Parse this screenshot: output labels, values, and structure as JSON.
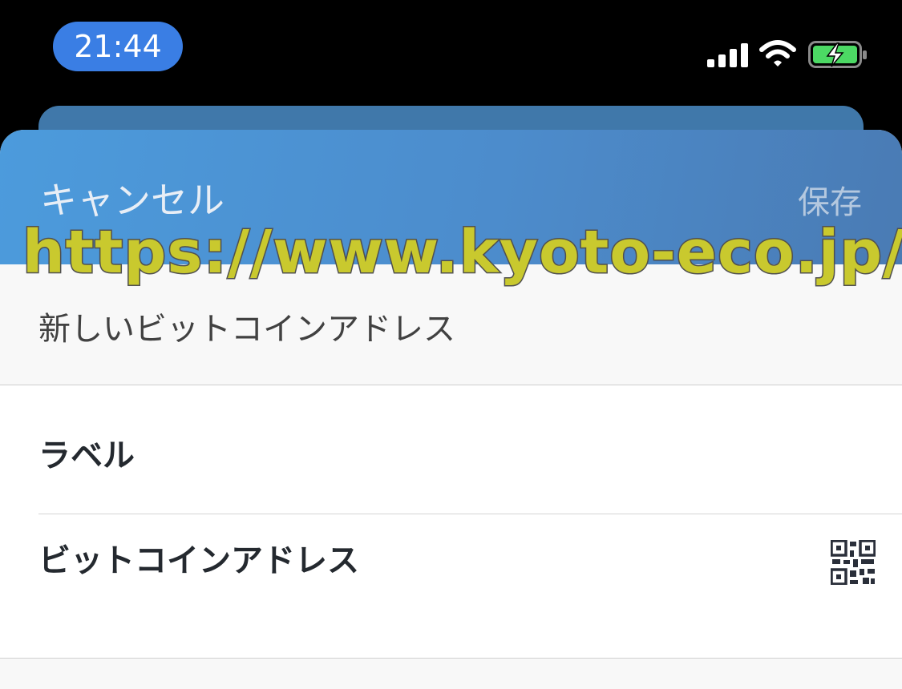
{
  "status_bar": {
    "time": "21:44",
    "signal_icon": "cellular-signal-icon",
    "wifi_icon": "wifi-icon",
    "battery_icon": "battery-charging-icon",
    "accent_color": "#3a7ee4",
    "battery_color": "#4cd964"
  },
  "sheet": {
    "header": {
      "cancel_label": "キャンセル",
      "save_label": "保存"
    },
    "subtitle": "新しいビットコインアドレス",
    "fields": {
      "label_field": "ラベル",
      "address_field": "ビットコインアドレス",
      "qr_icon": "qr-code-icon"
    }
  },
  "watermark": "https://www.kyoto-eco.jp/"
}
